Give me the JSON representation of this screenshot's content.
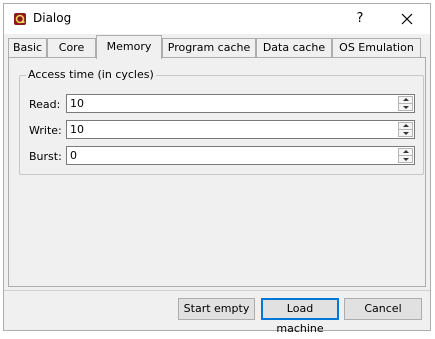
{
  "window": {
    "title": "Dialog",
    "icon": "qemu-icon"
  },
  "titlebar": {
    "help_label": "?",
    "close_icon": "close-icon"
  },
  "tabs": [
    {
      "label": "Basic"
    },
    {
      "label": "Core"
    },
    {
      "label": "Memory"
    },
    {
      "label": "Program cache"
    },
    {
      "label": "Data cache"
    },
    {
      "label": "OS Emulation"
    }
  ],
  "active_tab": "Memory",
  "access_time": {
    "group_title": "Access time (in cycles)",
    "read": {
      "label": "Read:",
      "value": "10"
    },
    "write": {
      "label": "Write:",
      "value": "10"
    },
    "burst": {
      "label": "Burst:",
      "value": "0"
    }
  },
  "buttons": {
    "start_empty": "Start empty",
    "load_machine": "Load machine",
    "cancel": "Cancel"
  }
}
